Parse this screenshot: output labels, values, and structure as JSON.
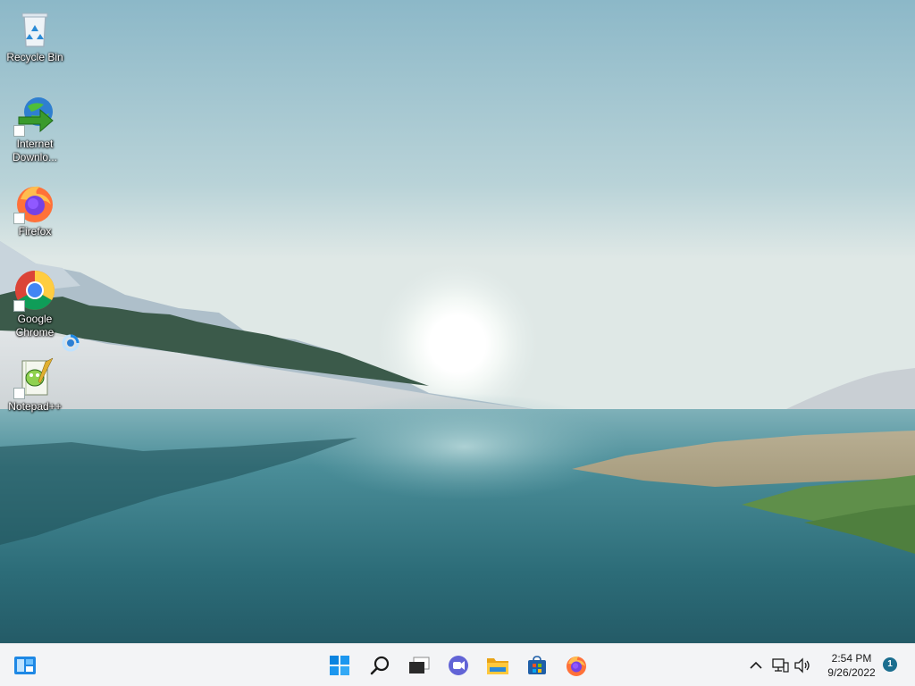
{
  "desktop": {
    "icons": [
      {
        "name": "recycle-bin",
        "label": "Recycle Bin"
      },
      {
        "name": "internet-download-manager",
        "label": "Internet Downlo..."
      },
      {
        "name": "firefox",
        "label": "Firefox"
      },
      {
        "name": "google-chrome",
        "label": "Google Chrome"
      },
      {
        "name": "notepad-plus-plus",
        "label": "Notepad++"
      }
    ],
    "wallpaper": "Windows 11 lake landscape"
  },
  "taskbar": {
    "widgets_icon": "widgets-icon",
    "apps": [
      {
        "name": "start",
        "icon": "windows-logo-icon"
      },
      {
        "name": "search",
        "icon": "search-icon"
      },
      {
        "name": "task-view",
        "icon": "task-view-icon"
      },
      {
        "name": "teams-chat",
        "icon": "chat-icon"
      },
      {
        "name": "file-explorer",
        "icon": "folder-icon"
      },
      {
        "name": "microsoft-store",
        "icon": "store-icon"
      },
      {
        "name": "firefox",
        "icon": "firefox-icon"
      }
    ],
    "tray": {
      "overflow_icon": "chevron-up-icon",
      "network_icon": "network-icon",
      "volume_icon": "volume-icon",
      "time": "2:54 PM",
      "date": "9/26/2022",
      "notification_count": "1"
    }
  },
  "colors": {
    "taskbar_bg": "#f3f4f6",
    "accent": "#0078d4",
    "sky": "#9fc3cf",
    "water": "#2f6f7c"
  }
}
